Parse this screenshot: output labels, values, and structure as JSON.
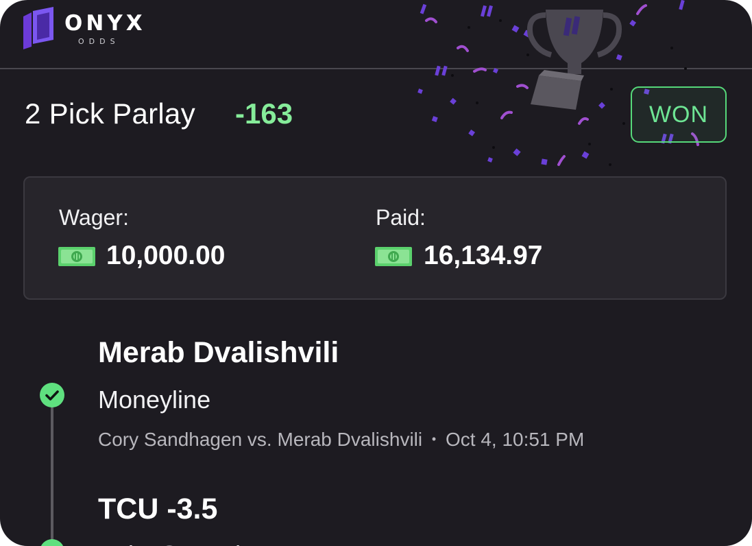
{
  "header": {
    "brand": "ONYX",
    "brand_sub": "ODDS",
    "logo_icon": "onyx-logo-icon"
  },
  "bet": {
    "title": "2 Pick Parlay",
    "odds": "-163",
    "status": "WON"
  },
  "summary": {
    "wager_label": "Wager:",
    "wager_amount": "10,000.00",
    "paid_label": "Paid:",
    "paid_amount": "16,134.97",
    "currency_icon": "dollar-bill-icon"
  },
  "picks": [
    {
      "selection": "Merab Dvalishvili",
      "market": "Moneyline",
      "event": "Cory Sandhagen vs. Merab Dvalishvili",
      "separator": "•",
      "time": "Oct 4, 10:51 PM",
      "status_icon": "check-circle-icon"
    },
    {
      "selection": "TCU -3.5",
      "market": "Point Spread",
      "status_icon": "check-circle-icon"
    }
  ],
  "colors": {
    "background": "#1d1b21",
    "accent_green": "#86ec9a",
    "won_border": "#56d97a",
    "confetti_purple": "#7b4fe0",
    "confetti_magenta": "#a45ad6"
  },
  "decor": {
    "trophy_icon": "trophy-icon",
    "confetti": "confetti-decoration"
  }
}
